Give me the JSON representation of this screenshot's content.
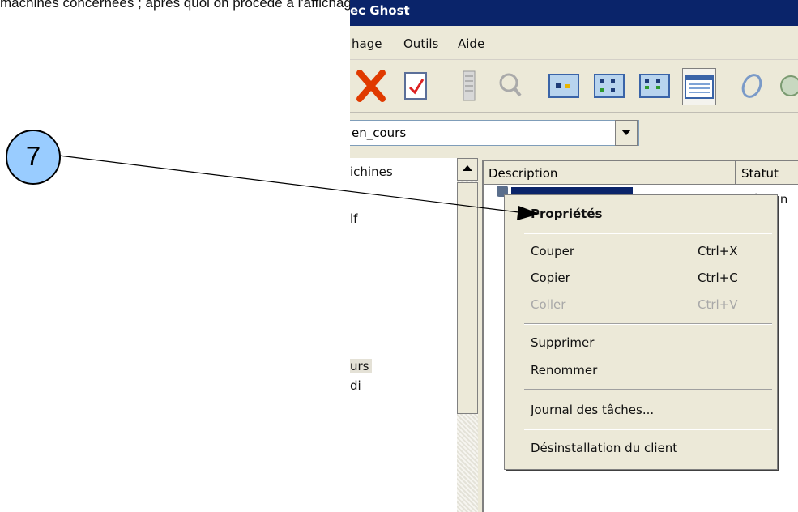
{
  "document": {
    "caption_fragment": "machines concernées ; après quoi on procède à l'affichage des « Propriétés » , en"
  },
  "window": {
    "title": "ec Ghost",
    "menu": [
      "hage",
      "Outils",
      "Aide"
    ]
  },
  "toolbar": {
    "icons": [
      "delete-icon",
      "properties-check-icon",
      "report-icon",
      "search-computer-icon",
      "view-large-icons-icon",
      "view-small-icons-icon",
      "view-list-icon",
      "view-details-icon",
      "refresh-icon"
    ]
  },
  "combo": {
    "value": "en_cours"
  },
  "tree": {
    "header": "ichines",
    "items": [
      "lf",
      "urs",
      "di"
    ]
  },
  "list": {
    "columns": [
      "Description",
      "Statut"
    ],
    "row_status": "Réconn"
  },
  "context_menu": {
    "properties": "Propriétés",
    "cut": "Couper",
    "cut_shortcut": "Ctrl+X",
    "copy": "Copier",
    "copy_shortcut": "Ctrl+C",
    "paste": "Coller",
    "paste_shortcut": "Ctrl+V",
    "delete": "Supprimer",
    "rename": "Renommer",
    "task_log": "Journal des tâches...",
    "uninstall_client": "Désinstallation du client"
  },
  "annotation": {
    "number": "7"
  },
  "colors": {
    "titlebar": "#0a246a",
    "menu_bg": "#ece9d8",
    "badge": "#99ccff",
    "delete_red": "#e03a00"
  }
}
